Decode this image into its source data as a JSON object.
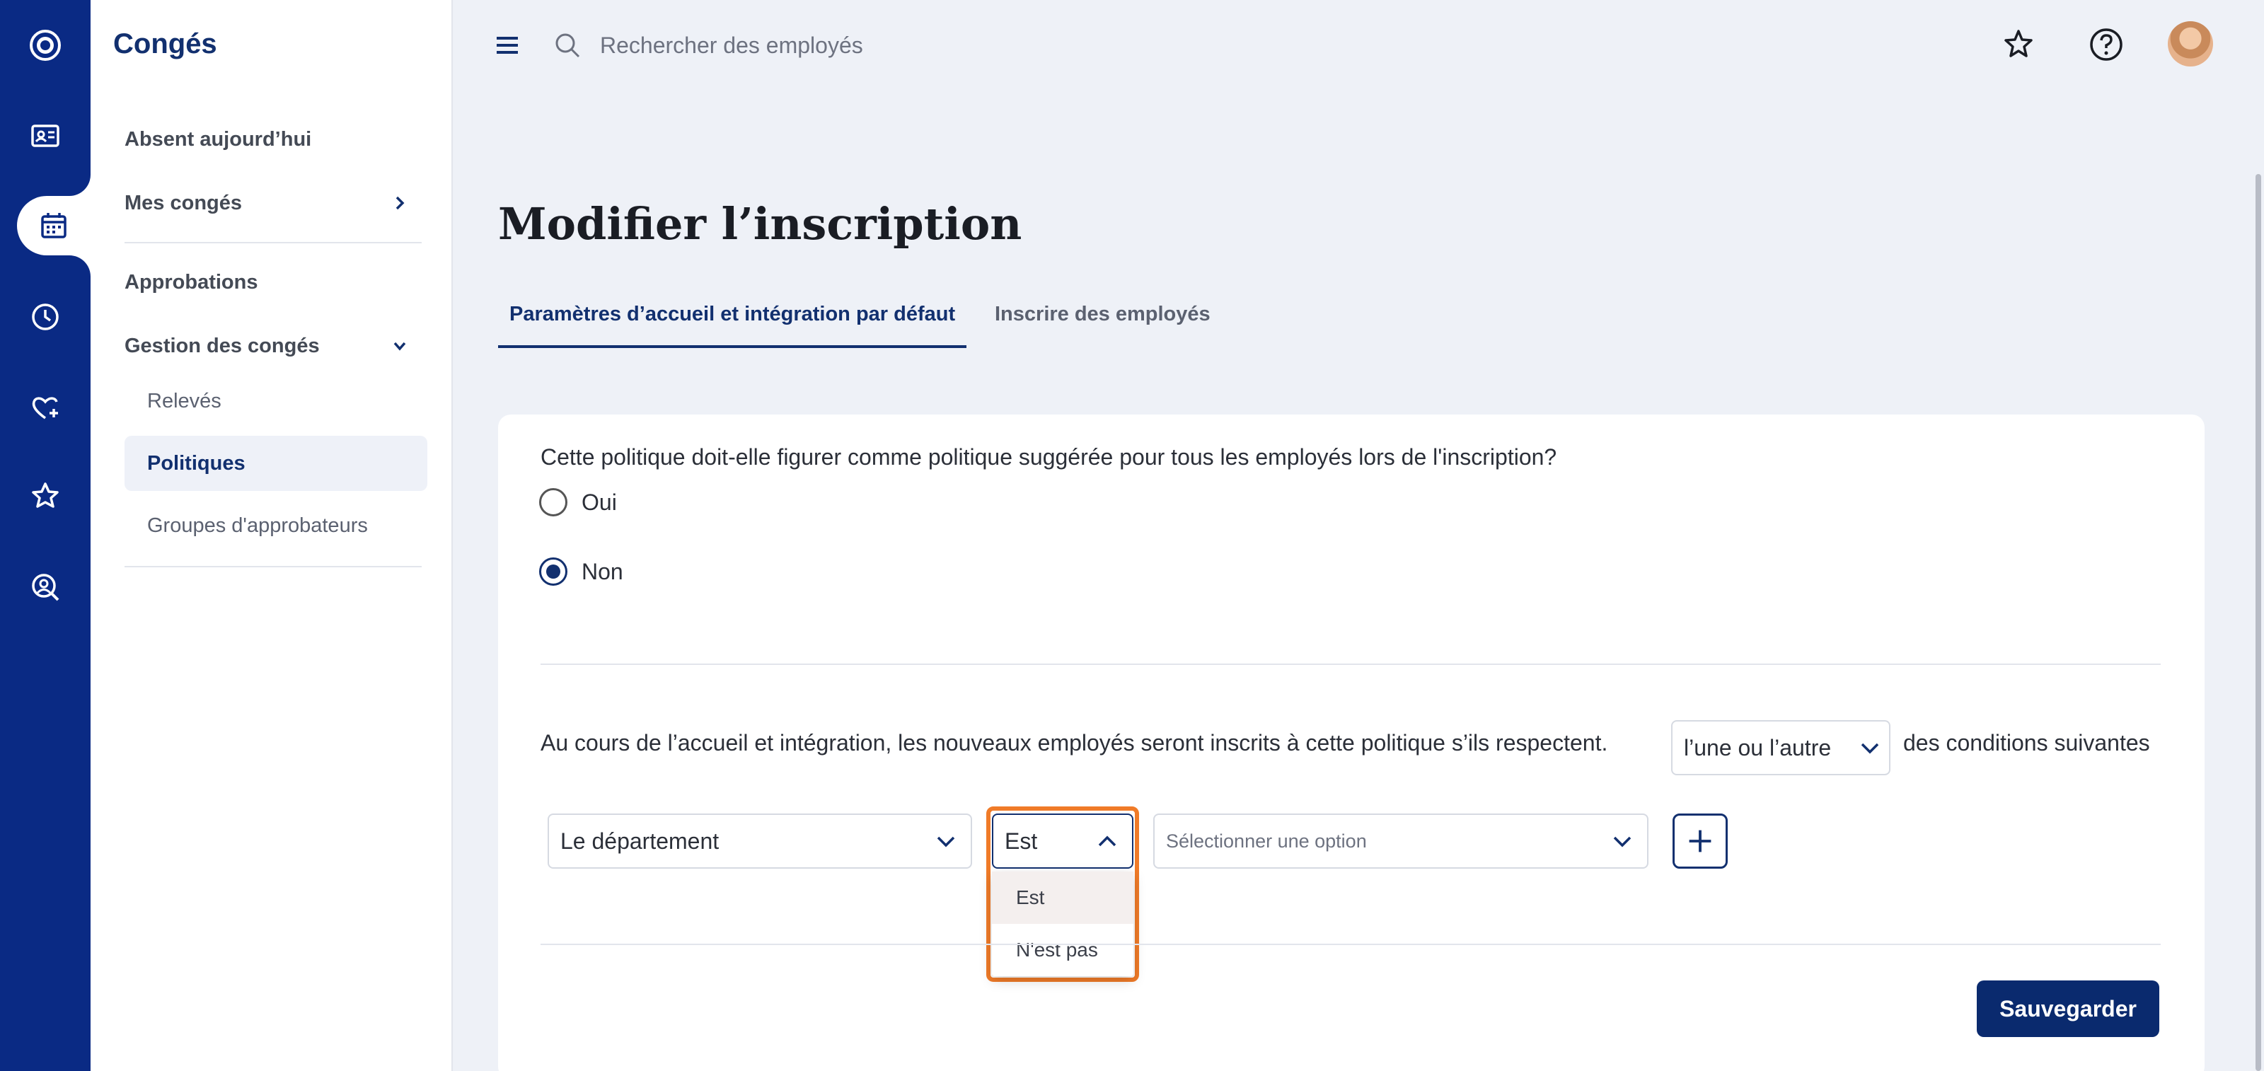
{
  "sidebar": {
    "title": "Congés",
    "items": [
      {
        "label": "Absent aujourd’hui"
      },
      {
        "label": "Mes congés"
      },
      {
        "label": "Approbations"
      },
      {
        "label": "Gestion des congés"
      },
      {
        "label": "Relevés"
      },
      {
        "label": "Politiques"
      },
      {
        "label": "Groupes d'approbateurs"
      }
    ]
  },
  "rail": {
    "icons": [
      "logo-icon",
      "id-card-icon",
      "calendar-icon",
      "clock-icon",
      "heart-plus-icon",
      "star-icon",
      "person-search-icon"
    ],
    "active": "calendar-icon"
  },
  "search": {
    "placeholder": "Rechercher des employés"
  },
  "header": {
    "icons": [
      "favorites-star-icon",
      "help-icon",
      "avatar"
    ]
  },
  "page": {
    "title": "Modifier l’inscription",
    "tabs": [
      {
        "label": "Paramètres d’accueil et intégration par défaut",
        "active": true
      },
      {
        "label": "Inscrire des employés",
        "active": false
      }
    ]
  },
  "form": {
    "question": "Cette politique doit-elle figurer comme politique suggérée pour tous les employés lors de l'inscription?",
    "options": [
      {
        "label": "Oui",
        "checked": false
      },
      {
        "label": "Non",
        "checked": true
      }
    ],
    "condition_prefix": "Au cours de l’accueil et intégration, les nouveaux employés seront inscrits à cette politique s’ils respectent.",
    "condition_mode": "l’une ou l’autre",
    "condition_suffix": "des conditions suivantes",
    "field_select": "Le département",
    "operator_select": "Est",
    "operator_options": [
      "Est",
      "N'est pas"
    ],
    "value_placeholder": "Sélectionner une option",
    "save_label": "Sauvegarder"
  },
  "colors": {
    "brand": "#0a2a84",
    "accent": "#12306f",
    "highlight": "#f07b28"
  }
}
